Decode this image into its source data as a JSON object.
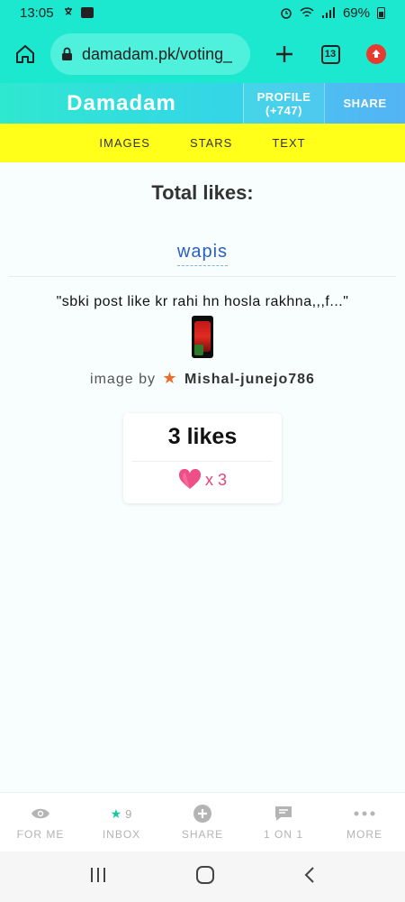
{
  "status_bar": {
    "time": "13:05",
    "battery": "69%"
  },
  "browser": {
    "url": "damadam.pk/voting_",
    "tabs_count": "13"
  },
  "site_header": {
    "brand": "Damadam",
    "profile_label": "PROFILE",
    "profile_points": "(+747)",
    "share_label": "SHARE"
  },
  "yellow_nav": {
    "images": "IMAGES",
    "stars": "STARS",
    "text": "TEXT"
  },
  "main": {
    "title": "Total likes:",
    "back_link": "wapis",
    "quote": "\"sbki post like kr rahi hn hosla rakhna,,,f...\"",
    "byline_prefix": "image by",
    "username": "Mishal-junejo786",
    "likes_count": "3 likes",
    "heart_multiplier": "x 3"
  },
  "bottom_nav": {
    "items": [
      {
        "label": "FOR ME",
        "icon": "eye-icon"
      },
      {
        "label": "INBOX",
        "icon": "star-icon",
        "badge": "9"
      },
      {
        "label": "SHARE",
        "icon": "plus-circle-icon"
      },
      {
        "label": "1 ON 1",
        "icon": "chat-icon"
      },
      {
        "label": "MORE",
        "icon": "more-dots-icon"
      }
    ]
  },
  "colors": {
    "brand_cyan": "#1ce8cf",
    "nav_yellow": "#ffff1a",
    "link_blue": "#2b5fbf",
    "heart_pink": "#e8437a",
    "star_orange": "#f06a28",
    "inbox_green": "#18c6a4"
  }
}
